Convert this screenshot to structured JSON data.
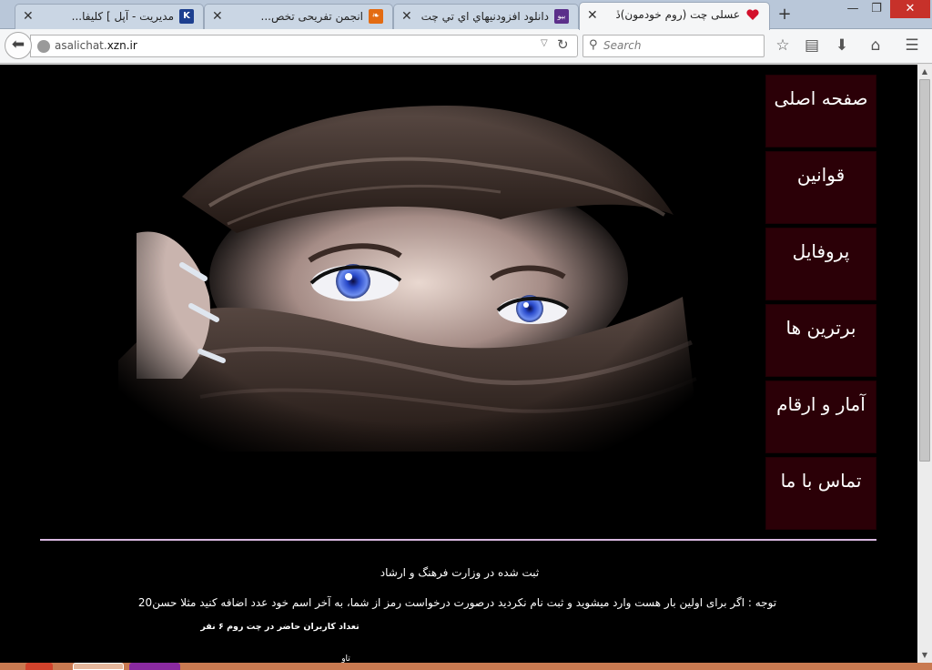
{
  "browser": {
    "tabs": [
      {
        "title": "عسلی چت (روم خودمون)ڏ",
        "favicon": "heart-icon",
        "favicon_color": "#d3102b",
        "active": true
      },
      {
        "title": "دانلود افزودنيهاي اي تي چت",
        "favicon": "site-favicon-purple",
        "favicon_glyph": "بیو",
        "favicon_color": "#5b2f8a",
        "active": false
      },
      {
        "title": "انجمن تفریحی تخص...",
        "favicon": "site-favicon-orange",
        "favicon_glyph": "❧",
        "favicon_color": "#e36b12",
        "active": false
      },
      {
        "title": "مدیریت - آپل ] كليفا...",
        "favicon": "site-favicon-k",
        "favicon_glyph": "K",
        "favicon_color": "#1d3f8f",
        "active": false
      }
    ],
    "url_prefix": "asalichat.",
    "url_domain": "xzn.ir",
    "search_placeholder": "Search"
  },
  "page": {
    "menu": [
      {
        "label": "صفحه اصلی"
      },
      {
        "label": "قوانین"
      },
      {
        "label": "پروفایل"
      },
      {
        "label": "برترین ها"
      },
      {
        "label": "آمار و ارقام"
      },
      {
        "label": "تماس با ما"
      }
    ],
    "registration_note": "ثبت شده در وزارت فرهنگ و ارشاد",
    "warning_note": "توجه : اگر برای اولین بار هست وارد میشوید و ثبت نام نکردید درصورت درخواست رمز از شما، به آخر اسم خود عدد اضافه کنید مثلا حسن20",
    "online_users": "تعداد کاربران حاضر در چت روم ۶ نفر",
    "more_indicator": "تاو"
  },
  "colors": {
    "page_bg": "#000000",
    "menu_item_bg": "#2b0007",
    "divider": "#d8b8e0",
    "tabstrip_bg": "#b9c7d9"
  }
}
